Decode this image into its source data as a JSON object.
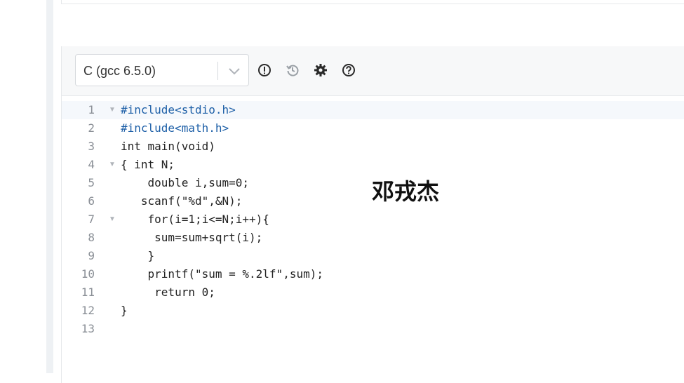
{
  "language_select": {
    "value": "C (gcc 6.5.0)"
  },
  "toolbar_icons": [
    "exclamation-circle-icon",
    "history-icon",
    "gear-icon",
    "question-circle-icon"
  ],
  "overlay_text": "邓戎杰",
  "line_numbers": [
    "1",
    "2",
    "3",
    "4",
    "5",
    "6",
    "7",
    "8",
    "9",
    "10",
    "11",
    "12",
    "13"
  ],
  "code_lines": [
    "#include<stdio.h>",
    "#include<math.h>",
    "int main(void)",
    "{ int N;",
    "    double i,sum=0;",
    "   scanf(\"%d\",&N);",
    "    for(i=1;i<=N;i++){",
    "     sum=sum+sqrt(i);",
    "    }",
    "    printf(\"sum = %.2lf\",sum);",
    "     return 0;",
    "}",
    "    "
  ]
}
